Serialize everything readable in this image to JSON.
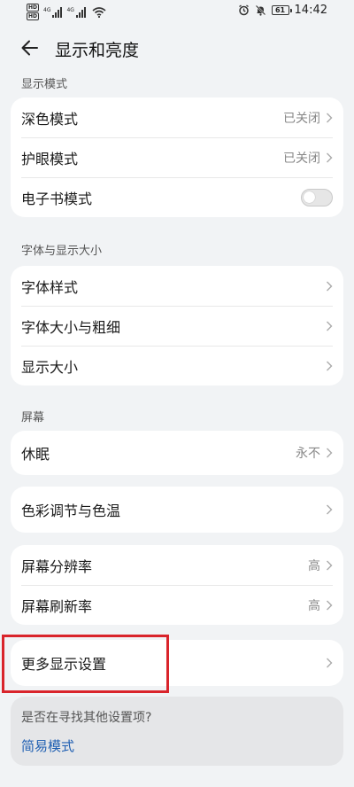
{
  "status_bar": {
    "sim1": "HD",
    "sim2": "HD",
    "network1": "4G",
    "network2": "4G",
    "battery": "61",
    "time": "14:42"
  },
  "header": {
    "title": "显示和亮度"
  },
  "sections": {
    "display_mode": {
      "label": "显示模式",
      "dark_mode": {
        "label": "深色模式",
        "value": "已关闭"
      },
      "eye_comfort": {
        "label": "护眼模式",
        "value": "已关闭"
      },
      "ebook_mode": {
        "label": "电子书模式",
        "enabled": false
      }
    },
    "font_size": {
      "label": "字体与显示大小",
      "font_style": {
        "label": "字体样式"
      },
      "font_size_weight": {
        "label": "字体大小与粗细"
      },
      "display_size": {
        "label": "显示大小"
      }
    },
    "screen": {
      "label": "屏幕",
      "sleep": {
        "label": "休眠",
        "value": "永不"
      },
      "color": {
        "label": "色彩调节与色温"
      },
      "resolution": {
        "label": "屏幕分辨率",
        "value": "高"
      },
      "refresh_rate": {
        "label": "屏幕刷新率",
        "value": "高"
      },
      "more": {
        "label": "更多显示设置"
      }
    }
  },
  "help": {
    "question": "是否在寻找其他设置项?",
    "link": "简易模式"
  },
  "colors": {
    "background": "#f1f3f5",
    "card": "#ffffff",
    "link": "#1f5fb2",
    "highlight": "#d9242b"
  }
}
